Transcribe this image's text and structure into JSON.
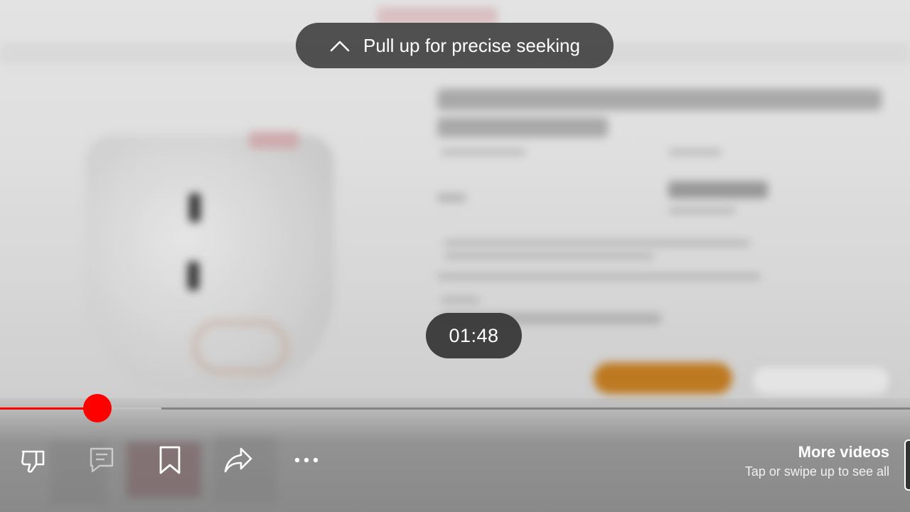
{
  "seek_hint": {
    "label": "Pull up for precise seeking",
    "icon": "chevron-up-icon"
  },
  "time_display": "01:48",
  "progress": {
    "played_fraction": 0.107,
    "buffered_fraction": 0.177,
    "color": "#ff0000"
  },
  "actions": [
    {
      "name": "dislike",
      "icon": "thumbs-down-icon"
    },
    {
      "name": "comments",
      "icon": "comment-icon"
    },
    {
      "name": "save",
      "icon": "bookmark-icon"
    },
    {
      "name": "share",
      "icon": "share-arrow-icon"
    },
    {
      "name": "more",
      "icon": "more-horizontal-icon"
    }
  ],
  "more_videos": {
    "title": "More videos",
    "subtitle": "Tap or swipe up to see all"
  }
}
